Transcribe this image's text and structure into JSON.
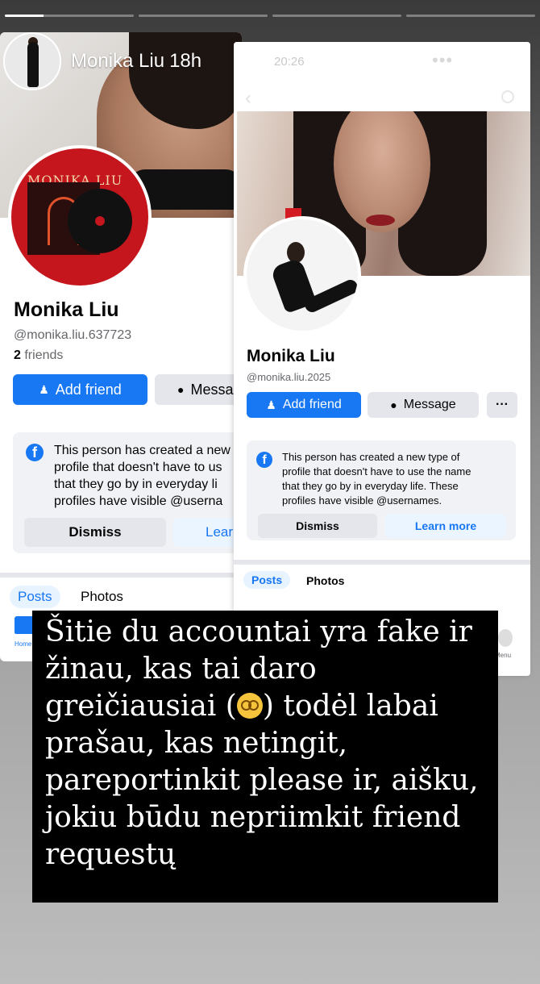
{
  "story": {
    "username": "Monika Liu",
    "time": "18h",
    "progress": [
      1,
      0,
      0,
      0
    ],
    "close_icon": "close-icon"
  },
  "left_profile": {
    "album_title": "MONIKA LIU",
    "name": "Monika Liu",
    "handle": "@monika.liu.637723",
    "friends_count": "2",
    "friends_label": "friends",
    "add_friend": "Add friend",
    "message": "Messa",
    "notice": "This person has created a new\nprofile that doesn't have to us\nthat they go by in everyday li\nprofiles have visible @userna",
    "dismiss": "Dismiss",
    "learn_more": "Lear",
    "tabs": [
      "Posts",
      "Photos"
    ],
    "home_label": "Home"
  },
  "right_profile": {
    "status_time": "20:26",
    "name": "Monika Liu",
    "handle": "@monika.liu.2025",
    "add_friend": "Add friend",
    "message": "Message",
    "more": "···",
    "notice": "This person has created a new type of\nprofile that doesn't have to use the name\nthat they go by in everyday life. These\nprofiles have visible @usernames.",
    "dismiss": "Dismiss",
    "learn_more": "Learn more",
    "tabs": [
      "Posts",
      "Photos"
    ],
    "menu_label": "Menu"
  },
  "caption": {
    "line1": "Šitie du accountai yra fake ir",
    "line2": "žinau, kas tai daro",
    "line3_before": "greičiausiai (",
    "line3_after": ") todėl labai",
    "line4": "prašau, kas netingit,",
    "line5": "pareportinkit please ir, aišku,",
    "line6": "jokiu būdu nepriimkit friend",
    "line7": "requestų",
    "emoji": "dizzy-face-emoji"
  },
  "colors": {
    "fb_blue": "#1877f2",
    "caption_bg": "#000000",
    "album_red": "#c4161c"
  }
}
